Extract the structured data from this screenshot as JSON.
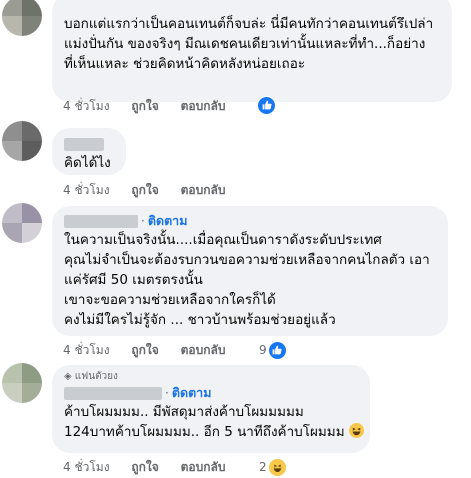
{
  "colors": {
    "bubble_bg": "#f0f2f5",
    "link_blue": "#1b74e4",
    "like_blue": "#1877f2",
    "meta_gray": "#65676b",
    "text": "#050505"
  },
  "actions": {
    "like": "ถูกใจ",
    "reply": "ตอบกลับ"
  },
  "comments": [
    {
      "lines": [
        "บอกแต่แรกว่าเป็นคอนเทนต์ก็จบล่ะ นี่มีคนทักว่าคอนเทนต์รึเปล่า",
        "แม่งปั่นกัน ของจริงๆ มีณเดชคนเดียวเท่านั้นแหละที่ทำ...ก็อย่าง",
        "ที่เห็นแหละ ช่วยคิดหน้าคิดหลังหน่อยเถอะ"
      ],
      "time": "4 ชั่วโมง",
      "reaction": {
        "icon": "like-icon",
        "count": ""
      }
    },
    {
      "lines": [
        "คิดได้ไง"
      ],
      "time": "4 ชั่วโมง"
    },
    {
      "follow": "ติดตาม",
      "lines": [
        "ในความเป็นจริงนั้น....เมื่อคุณเป็นดาราดังระดับประเทศ",
        "คุณไม่จำเป็นจะต้องรบกวนขอความช่วยเหลือจากคนไกลตัว เอา",
        "แค่รัศมี 50 เมตรตรงนั้น",
        "เขาจะขอความช่วยเหลือจากใครก็ได้",
        "คงไม่มีใครไม่รู้จัก ... ชาวบ้านพร้อมช่วยอยู่แล้ว"
      ],
      "time": "4 ชั่วโมง",
      "reaction": {
        "icon": "like-icon",
        "count": "9"
      }
    },
    {
      "badge": "แฟนตัวยง",
      "follow": "ติดตาม",
      "lines": [
        "ค้าบโผมมมม.. มีพัสดุมาส่งค้าบโผมมมมม",
        "124บาทค้าบโผมมมม.. อีก 5 นาทีถึงค้าบโผมมม"
      ],
      "inline_emoji": "grinning-squinting-face-icon",
      "time": "4 ชั่วโมง",
      "reaction": {
        "icon": "haha-icon",
        "count": "2"
      }
    }
  ]
}
